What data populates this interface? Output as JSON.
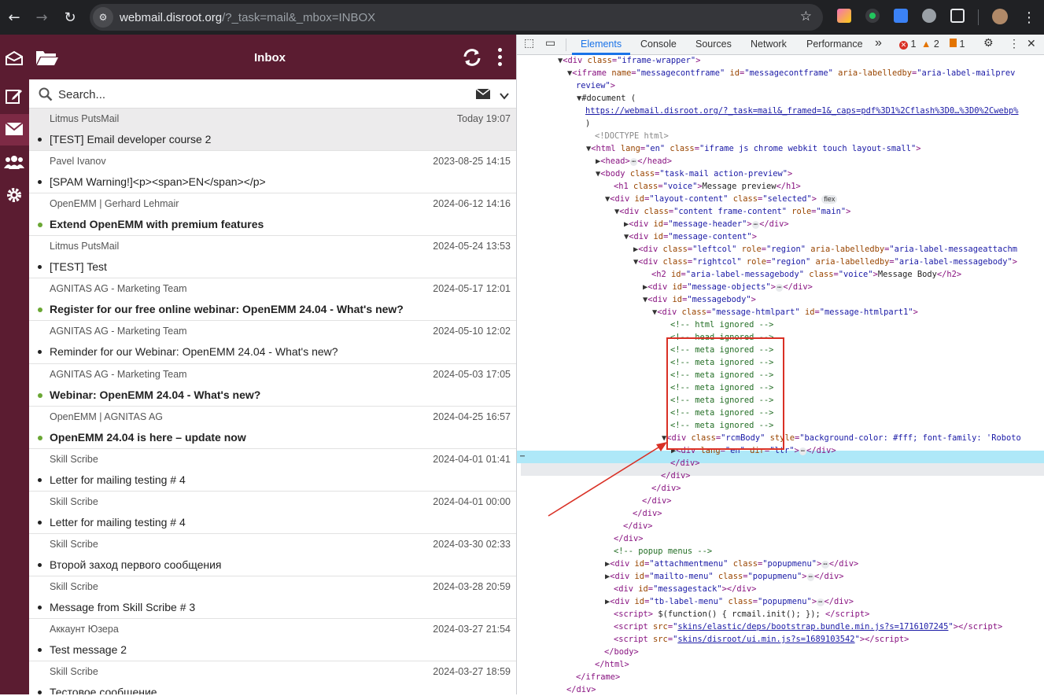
{
  "browser": {
    "url_host": "webmail.disroot.org",
    "url_path": "/?_task=mail&_mbox=INBOX"
  },
  "app": {
    "title": "Inbox",
    "search_placeholder": "Search..."
  },
  "messages": [
    {
      "from": "Litmus PutsMail",
      "date": "Today 19:07",
      "subject": "[TEST] Email developer course 2",
      "unread": false,
      "selected": true
    },
    {
      "from": "Pavel Ivanov",
      "date": "2023-08-25 14:15",
      "subject": "[SPAM Warning!]<p><span>EN</span></p>",
      "unread": false
    },
    {
      "from": "OpenEMM | Gerhard Lehmair",
      "date": "2024-06-12 14:16",
      "subject": "Extend OpenEMM with premium features",
      "unread": true
    },
    {
      "from": "Litmus PutsMail",
      "date": "2024-05-24 13:53",
      "subject": "[TEST] Test",
      "unread": false
    },
    {
      "from": "AGNITAS AG - Marketing Team",
      "date": "2024-05-17 12:01",
      "subject": "Register for our free online webinar: OpenEMM 24.04 - What's new?",
      "unread": true
    },
    {
      "from": "AGNITAS AG - Marketing Team",
      "date": "2024-05-10 12:02",
      "subject": "Reminder for our Webinar: OpenEMM 24.04 - What's new?",
      "unread": false
    },
    {
      "from": "AGNITAS AG - Marketing Team",
      "date": "2024-05-03 17:05",
      "subject": "Webinar: OpenEMM 24.04 - What's new?",
      "unread": true
    },
    {
      "from": "OpenEMM | AGNITAS AG",
      "date": "2024-04-25 16:57",
      "subject": "OpenEMM 24.04 is here – update now",
      "unread": true
    },
    {
      "from": "Skill Scribe",
      "date": "2024-04-01 01:41",
      "subject": "Letter for mailing testing # 4",
      "unread": false
    },
    {
      "from": "Skill Scribe",
      "date": "2024-04-01 00:00",
      "subject": "Letter for mailing testing # 4",
      "unread": false
    },
    {
      "from": "Skill Scribe",
      "date": "2024-03-30 02:33",
      "subject": "Второй заход первого сообщения",
      "unread": false
    },
    {
      "from": "Skill Scribe",
      "date": "2024-03-28 20:59",
      "subject": "Message from Skill Scribe # 3",
      "unread": false
    },
    {
      "from": "Аккаунт Юзера",
      "date": "2024-03-27 21:54",
      "subject": "Test message 2",
      "unread": false
    },
    {
      "from": "Skill Scribe",
      "date": "2024-03-27 18:59",
      "subject": "Тестовое сообщение",
      "unread": false
    }
  ],
  "devtools": {
    "tabs": [
      "Elements",
      "Console",
      "Sources",
      "Network",
      "Performance"
    ],
    "more": "»",
    "errors": "1",
    "warnings": "2",
    "issues": "1"
  },
  "colors": {
    "sidebar": "#5b1c31",
    "accent_blue": "#1a73e8",
    "unread_dot": "#6aa734",
    "highlight": "#d93025"
  }
}
